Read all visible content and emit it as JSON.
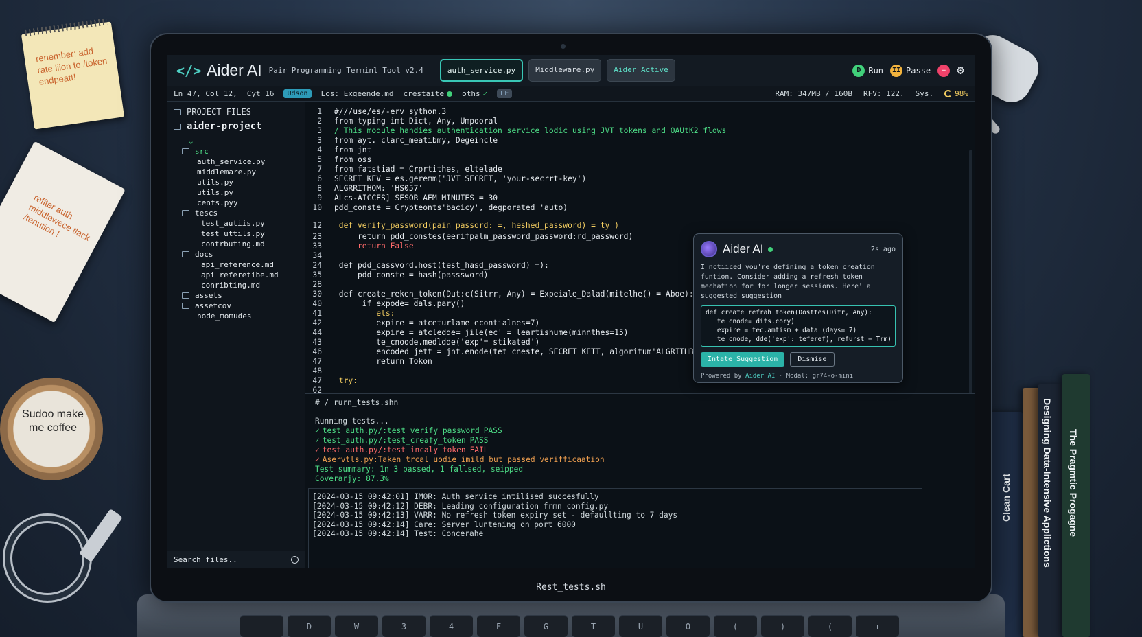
{
  "app": {
    "logo_icon": "</>",
    "title": "Aider AI",
    "subtitle": "Pair Programming Terminl Tool v2.4",
    "tabs": [
      {
        "label": "auth_service.py",
        "active": true
      },
      {
        "label": "Middleware.py",
        "active": false
      },
      {
        "label": "Aider Active",
        "active": false
      }
    ],
    "actions": {
      "run": "Run",
      "pause": "Passe"
    },
    "accent": "#39c6b5"
  },
  "statusline": {
    "position": "Ln 47, Col 12,",
    "cyt": "Cyt 16",
    "badge": "Udson",
    "los": "Los: Exgeende.md",
    "crestaite": "crestaite",
    "oths": "oths",
    "lf": "LF",
    "ram": "RAM: 347MB / 160B",
    "rfv": "RFV: 122.",
    "sys": "Sys.",
    "battery": "98%"
  },
  "sidebar": {
    "header": "PROJECT FILES",
    "project": "aider-project",
    "chevron": "⌄",
    "tree": [
      {
        "label": "src",
        "type": "dir",
        "indent": 1,
        "color": "green"
      },
      {
        "label": "auth_service.py",
        "type": "file",
        "indent": 2
      },
      {
        "label": "middlemare.py",
        "type": "file",
        "indent": 2
      },
      {
        "label": "utils.py",
        "type": "file",
        "indent": 2
      },
      {
        "label": "utils.py",
        "type": "file",
        "indent": 2
      },
      {
        "label": "cenfs.pyy",
        "type": "file",
        "indent": 2
      },
      {
        "label": "tescs",
        "type": "dir",
        "indent": 1
      },
      {
        "label": "test_autiis.py",
        "type": "file",
        "indent": 3
      },
      {
        "label": "test_uttils.py",
        "type": "file",
        "indent": 3
      },
      {
        "label": "contrbuting.md",
        "type": "file",
        "indent": 3
      },
      {
        "label": "docs",
        "type": "dir",
        "indent": 1
      },
      {
        "label": "api_reference.md",
        "type": "file",
        "indent": 3
      },
      {
        "label": "api_referetibe.md",
        "type": "file",
        "indent": 3
      },
      {
        "label": "conribting.md",
        "type": "file",
        "indent": 3
      },
      {
        "label": "assets",
        "type": "dir",
        "indent": 1
      },
      {
        "label": "assetcov",
        "type": "dir",
        "indent": 1
      },
      {
        "label": "node_momudes",
        "type": "file",
        "indent": 2
      }
    ],
    "search_placeholder": "Search files.."
  },
  "editor": {
    "lines": [
      {
        "n": "1",
        "t": "#///use/es/-erv sython.3",
        "c": ""
      },
      {
        "n": "2",
        "t": "from typing imt Dict, Any, Umpooral",
        "c": ""
      },
      {
        "n": "3",
        "t": "/ This module handies authentication service lodic using JVT tokens and OAUtK2 flows",
        "c": "green"
      },
      {
        "n": "3",
        "t": "from ayt. clarc_meatibmy, Degeincle",
        "c": ""
      },
      {
        "n": "4",
        "t": "from jnt",
        "c": ""
      },
      {
        "n": "5",
        "t": "from oss",
        "c": ""
      },
      {
        "n": "7",
        "t": "from fatstiad = Crprtithes, eltelade",
        "c": ""
      },
      {
        "n": "6",
        "t": "SECRET KEV = es.geremm('JVT_SECRET, 'your-secrrt-key')",
        "c": ""
      },
      {
        "n": "8",
        "t": "ALGRRITHOM: 'HS057'",
        "c": ""
      },
      {
        "n": "9",
        "t": "ALcs-AICCES]_SESOR_AEM_MINUTES = 30",
        "c": ""
      },
      {
        "n": "10",
        "t": "pdd_conste = Crypteonts'bacicy', degporated 'auto)",
        "c": ""
      },
      {
        "n": "12",
        "t": " def verify_password(pain passord: =, heshed_password) = ty )",
        "c": "yellow"
      },
      {
        "n": "23",
        "t": "     return pdd_constes(eerifpalm_password_password:rd_password)",
        "c": ""
      },
      {
        "n": "33",
        "t": "     return False",
        "c": "red"
      },
      {
        "n": "34",
        "t": "",
        "c": ""
      },
      {
        "n": "24",
        "t": " def pdd_cassvord.host(test_hasd_password) =):",
        "c": ""
      },
      {
        "n": "35",
        "t": "     pdd_conste = hash(passsword)",
        "c": ""
      },
      {
        "n": "28",
        "t": "",
        "c": ""
      },
      {
        "n": "30",
        "t": " def create_reken_token(Dut:c(Sitrr, Any) = Expeiale_Dalad(mitelhe() = Aboe):",
        "c": ""
      },
      {
        "n": "40",
        "t": "      if expode= dals.pary()",
        "c": ""
      },
      {
        "n": "41",
        "t": "         els:",
        "c": "yellow"
      },
      {
        "n": "42",
        "t": "         expire = atceturlame econtialnes=7)",
        "c": ""
      },
      {
        "n": "44",
        "t": "         expire = atcledde= jile(ec' = leartishume(minnthes=15)",
        "c": ""
      },
      {
        "n": "43",
        "t": "         te_cnoode.medldde('exp'= stikated')",
        "c": ""
      },
      {
        "n": "46",
        "t": "         encoded_jett = jnt.enode(tet_cneste, SECRET_KETT, algoritum'ALGRITHB')",
        "c": ""
      },
      {
        "n": "47",
        "t": "         return Tokon",
        "c": ""
      },
      {
        "n": "48",
        "t": "",
        "c": ""
      },
      {
        "n": "47",
        "t": " try:",
        "c": "yellow"
      },
      {
        "n": "62",
        "t": "",
        "c": ""
      }
    ]
  },
  "terminal": {
    "prompt": "# / rurn_tests.shn",
    "running": "Running tests...",
    "results": [
      {
        "mark": "✓",
        "text": "test_auth.py/:test_verify_password",
        "status": "PASS",
        "ok": true
      },
      {
        "mark": "✓",
        "text": "test_auth.py/:test_creafy_token",
        "status": "PASS",
        "ok": true
      },
      {
        "mark": "✓",
        "text": "test_auth.py/:test_incaly_token",
        "status": "FAIL",
        "ok": false
      },
      {
        "mark": "✓",
        "text": "Aservtls.py:Taken trcal uodie imild but passed verifficaation",
        "status": "",
        "ok": false
      }
    ],
    "summary": "Test summary: 1n 3 passed, 1 fallsed, seipped",
    "coverage": "Coverarjy: 87.3%",
    "logs": [
      "[2024-03-15 09:42:01] IMOR: Auth service intilised succesfully",
      "[2024-03-15 09:42:12] DEBR: Leading configuration frmn config.py",
      "[2024-03-15 09:42:13] VARR: No refresh token expiry set - defaullting to 7 days",
      "[2024-03-15 09:42:14] Care: Server luntening on port 6000",
      "[2024-03-15 09:42:14] Test: Concerahe"
    ]
  },
  "popup": {
    "title": "Aider AI",
    "time": "2s ago",
    "message": "I nctiiced you're defining a token creation funtion. Consider adding a refresh token mechation for for longer sessions. Here' a suggested suggestion",
    "code": [
      "def create_refrah_token(Dosttes(Ditr, Any):",
      "   te_cnode= dits.cory)",
      "   expire = tec.amtism + data (days= 7)",
      "   te_cnode, dde('exp': teferef), refurst = Trm)"
    ],
    "primary_btn": "Intate Suggestion",
    "secondary_btn": "Dismise",
    "footer_prefix": "Prowered by",
    "footer_brand": "Aider AI",
    "footer_model": "· Modal: gr74-o-mini"
  },
  "bottom_filename": "Rest_tests.sh",
  "keyboard": [
    "—",
    "D",
    "W",
    "3",
    "4",
    "F",
    "G",
    "T",
    "U",
    "O",
    "(",
    ")",
    "(",
    "+"
  ],
  "desk": {
    "sticky_note": "renember: add rate liion to /token endpeatt!",
    "notebook_note": "refiter auth middlewece tlack /tenution !",
    "mug": "Sudoo make me coffee",
    "books": [
      "Clean Cart",
      "Designing Data-Intensive Applictions",
      "The Pragmtic Progagne"
    ]
  }
}
